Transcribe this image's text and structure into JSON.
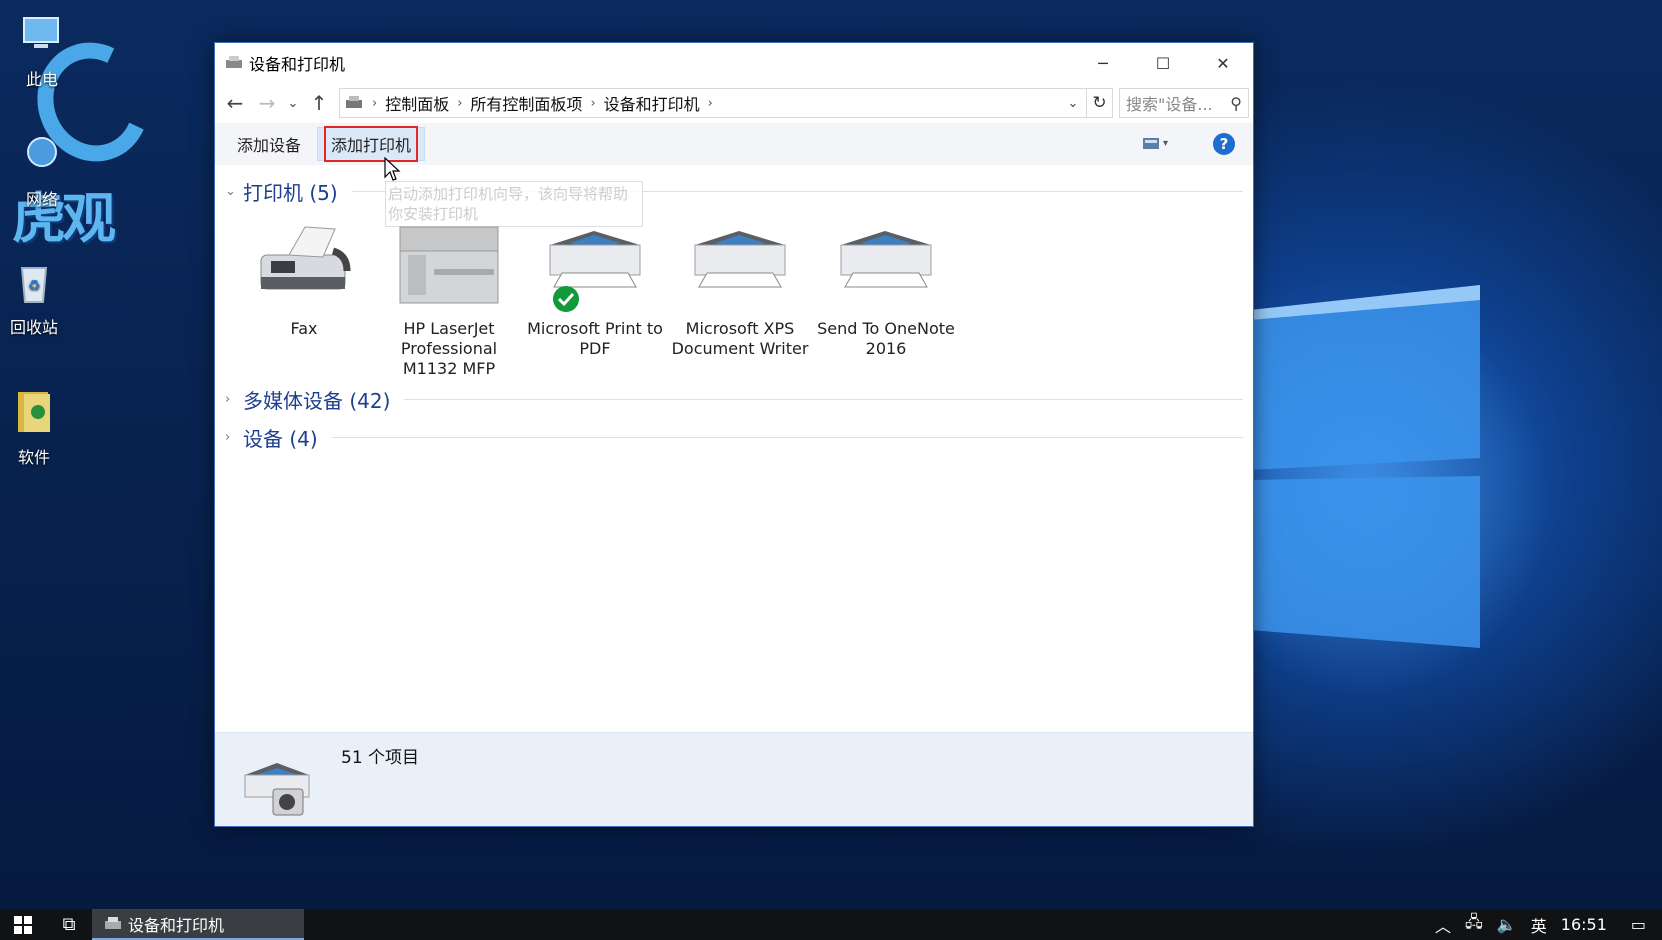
{
  "desktop": {
    "icons": [
      {
        "label": "此电",
        "icon": "computer-icon"
      },
      {
        "label": "网络",
        "icon": "network-icon"
      },
      {
        "label": "回收站",
        "icon": "recycle-bin-icon"
      },
      {
        "label": "软件",
        "icon": "folder-icon"
      }
    ],
    "watermark": "虎观"
  },
  "window": {
    "title": "设备和打印机",
    "controls": {
      "minimize": "─",
      "maximize": "☐",
      "close": "✕"
    },
    "breadcrumb": [
      "控制面板",
      "所有控制面板项",
      "设备和打印机"
    ],
    "search_placeholder": "搜索\"设备...",
    "toolbar": {
      "add_device": "添加设备",
      "add_printer": "添加打印机",
      "help": "?"
    },
    "tooltip": "启动添加打印机向导，该向导将帮助你安装打印机",
    "groups": {
      "printers": "打印机 (5)",
      "multimedia": "多媒体设备 (42)",
      "devices": "设备 (4)"
    },
    "printers": [
      {
        "label": "Fax",
        "icon": "fax-icon"
      },
      {
        "label": "HP LaserJet Professional M1132 MFP",
        "icon": "mfp-printer-icon"
      },
      {
        "label": "Microsoft Print to PDF",
        "icon": "printer-icon",
        "default": true
      },
      {
        "label": "Microsoft XPS Document Writer",
        "icon": "printer-icon"
      },
      {
        "label": "Send To OneNote 2016",
        "icon": "printer-icon"
      }
    ],
    "status": {
      "count": "51 个项目"
    }
  },
  "taskbar": {
    "app": "设备和打印机",
    "ime": "英",
    "time": "16:51"
  }
}
